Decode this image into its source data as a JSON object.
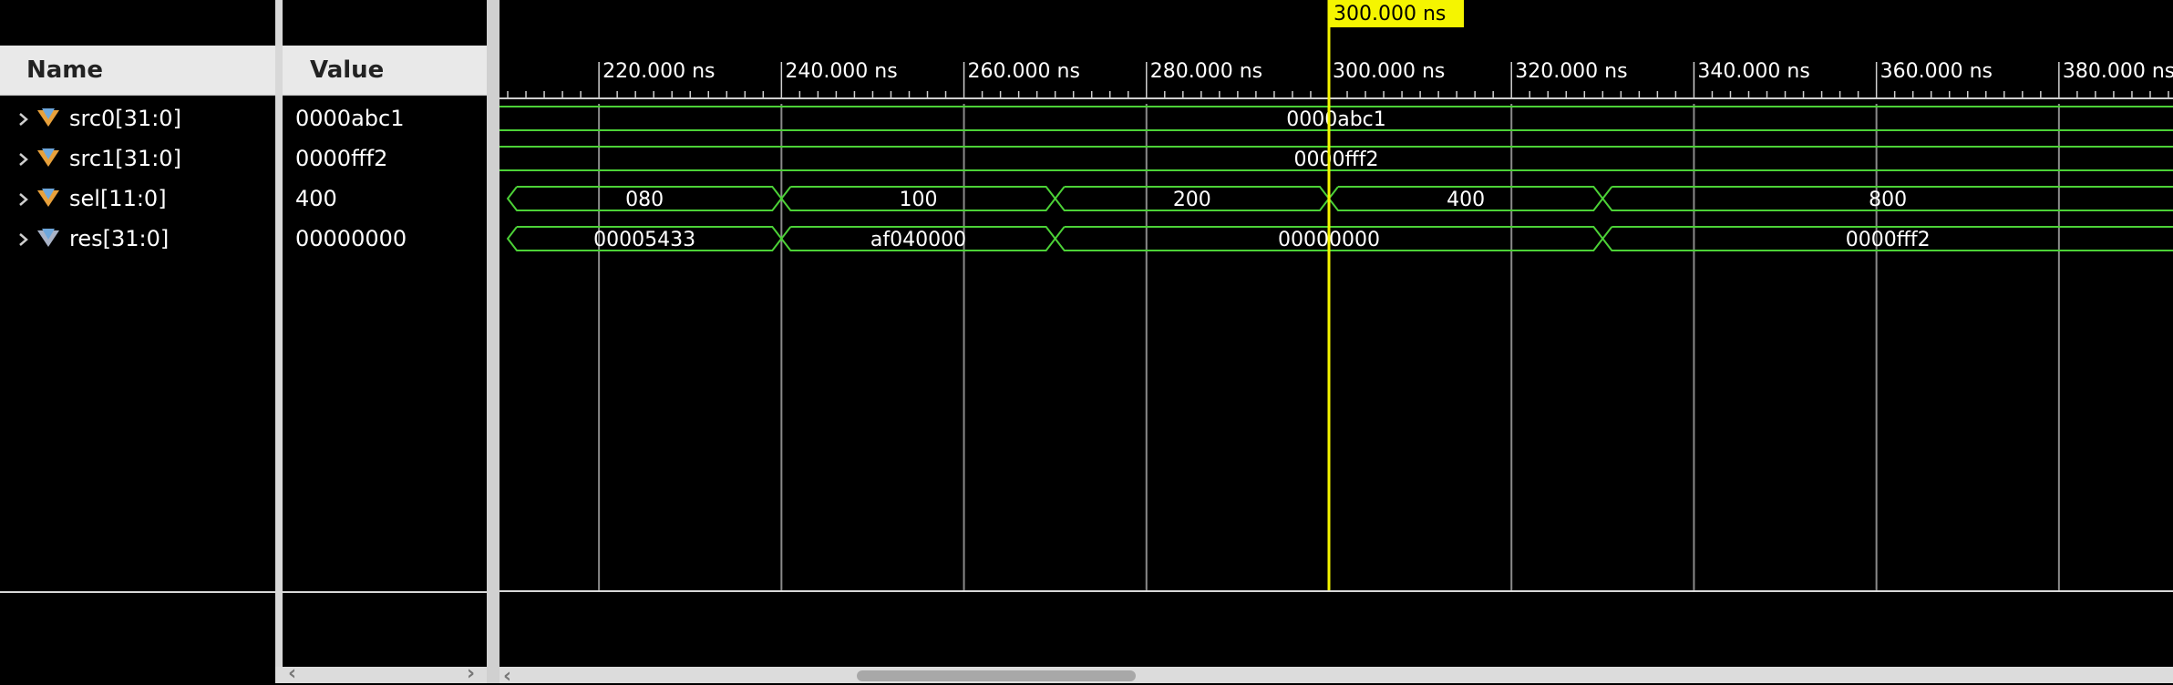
{
  "columns": {
    "name": "Name",
    "value": "Value"
  },
  "signals": [
    {
      "name": "src0[31:0]",
      "value": "0000abc1",
      "icon": "bus-signal-icon"
    },
    {
      "name": "src1[31:0]",
      "value": "0000fff2",
      "icon": "bus-signal-icon"
    },
    {
      "name": "sel[11:0]",
      "value": "400",
      "icon": "bus-signal-icon"
    },
    {
      "name": "res[31:0]",
      "value": "00000000",
      "icon": "bus-signal-icon"
    }
  ],
  "cursor": {
    "time_ns": 300,
    "label": "300.000 ns",
    "color": "#f5f500"
  },
  "timeline": {
    "start_ns": 209.1,
    "end_ns": 392.5,
    "ticks": [
      {
        "ns": 220,
        "label": "220.000 ns"
      },
      {
        "ns": 240,
        "label": "240.000 ns"
      },
      {
        "ns": 260,
        "label": "260.000 ns"
      },
      {
        "ns": 280,
        "label": "280.000 ns"
      },
      {
        "ns": 300,
        "label": "300.000 ns"
      },
      {
        "ns": 320,
        "label": "320.000 ns"
      },
      {
        "ns": 340,
        "label": "340.000 ns"
      },
      {
        "ns": 360,
        "label": "360.000 ns"
      },
      {
        "ns": 380,
        "label": "380.000 ns"
      }
    ]
  },
  "waveforms": [
    {
      "signal": "src0[31:0]",
      "segments": [
        {
          "start": 209.1,
          "end": 392.5,
          "value": "0000abc1"
        }
      ]
    },
    {
      "signal": "src1[31:0]",
      "segments": [
        {
          "start": 209.1,
          "end": 392.5,
          "value": "0000fff2"
        }
      ]
    },
    {
      "signal": "sel[11:0]",
      "segments": [
        {
          "start": 210,
          "end": 240,
          "value": "080"
        },
        {
          "start": 240,
          "end": 270,
          "value": "100"
        },
        {
          "start": 270,
          "end": 300,
          "value": "200"
        },
        {
          "start": 300,
          "end": 330,
          "value": "400"
        },
        {
          "start": 330,
          "end": 392.5,
          "value": "800"
        }
      ]
    },
    {
      "signal": "res[31:0]",
      "segments": [
        {
          "start": 210,
          "end": 240,
          "value": "00005433"
        },
        {
          "start": 240,
          "end": 270,
          "value": "af040000"
        },
        {
          "start": 270,
          "end": 330,
          "value": "00000000"
        },
        {
          "start": 330,
          "end": 392.5,
          "value": "0000fff2"
        }
      ]
    }
  ],
  "colors": {
    "wave": "#4cd137",
    "grid": "#8a8a8a",
    "background": "#000000",
    "header": "#e9e9e9"
  }
}
